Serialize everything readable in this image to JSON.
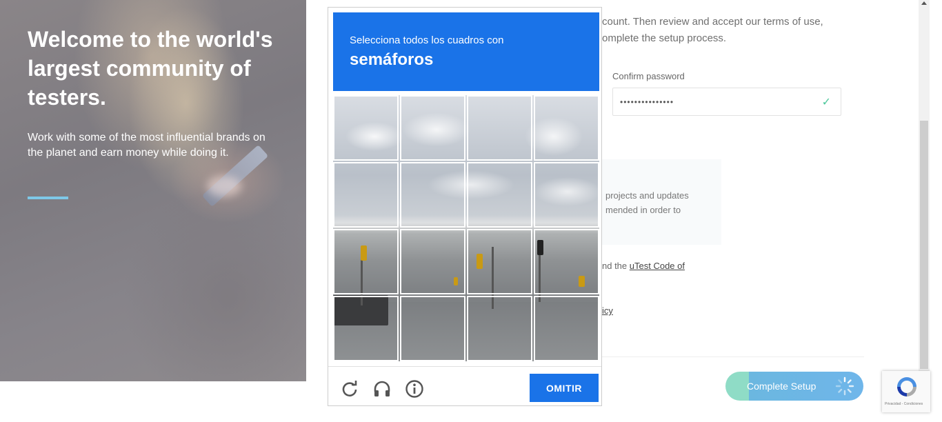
{
  "hero": {
    "headline": "Welcome to the world's largest community of testers.",
    "subtext": "Work with some of the most influential brands on the planet and earn money while doing it."
  },
  "form": {
    "intro_text": "count. Then review and accept our terms of use, omplete the setup process.",
    "confirm_password_label": "Confirm password",
    "confirm_password_value": "•••••••••••••••",
    "info_text": "projects and updates mended in order to",
    "agree_prefix": "nd the ",
    "code_link": "uTest Code of",
    "policy_link": "icy",
    "complete_label": "Complete Setup"
  },
  "captcha": {
    "instruction": "Selecciona todos los cuadros con",
    "target": "semáforos",
    "skip_label": "OMITIR",
    "icons": [
      "reload-icon",
      "headphones-icon",
      "info-icon"
    ]
  },
  "badge": {
    "footer": "Privacidad - Condiciones"
  },
  "colors": {
    "captcha_blue": "#1a73e8",
    "accent_teal": "#8fdcc6",
    "accent_blue": "#6fb6ea",
    "hero_rule": "#7ec8e8"
  }
}
